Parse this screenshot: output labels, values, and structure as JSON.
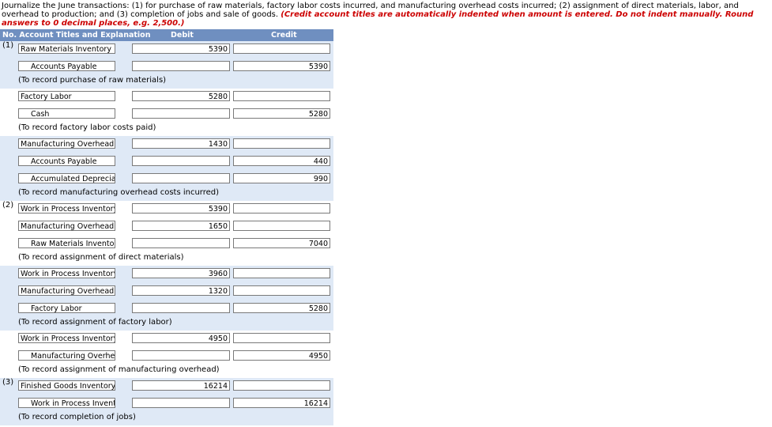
{
  "instructions": {
    "text": "Journalize the June transactions: (1) for purchase of raw materials, factory labor costs incurred, and manufacturing overhead costs incurred; (2) assignment of direct materials, labor, and overhead to production; and (3) completion of jobs and sale of goods.",
    "note": "(Credit account titles are automatically indented when amount is entered. Do not indent manually. Round answers to 0 decimal places, e.g. 2,500.)"
  },
  "header": {
    "col1": "No. Account Titles and Explanation",
    "col2": "Debit",
    "col3": "Credit"
  },
  "entries": [
    {
      "num": "(1)",
      "lines": [
        {
          "account": "Raw Materials Inventory",
          "debit": "5390",
          "credit": ""
        },
        {
          "account": "Accounts Payable",
          "debit": "",
          "credit": "5390"
        }
      ],
      "explanation": "(To record purchase of raw materials)"
    },
    {
      "num": "",
      "lines": [
        {
          "account": "Factory Labor",
          "debit": "5280",
          "credit": ""
        },
        {
          "account": "Cash",
          "debit": "",
          "credit": "5280"
        }
      ],
      "explanation": "(To record factory labor costs paid)"
    },
    {
      "num": "",
      "lines": [
        {
          "account": "Manufacturing Overhead",
          "debit": "1430",
          "credit": ""
        },
        {
          "account": "Accounts Payable",
          "debit": "",
          "credit": "440"
        },
        {
          "account": "Accumulated Depreciat",
          "debit": "",
          "credit": "990"
        }
      ],
      "explanation": "(To record manufacturing overhead costs incurred)"
    },
    {
      "num": "(2)",
      "lines": [
        {
          "account": "Work in Process Inventory",
          "debit": "5390",
          "credit": ""
        },
        {
          "account": "Manufacturing Overhead",
          "debit": "1650",
          "credit": ""
        },
        {
          "account": "Raw Materials Inventor",
          "debit": "",
          "credit": "7040"
        }
      ],
      "explanation": "(To record assignment of direct materials)"
    },
    {
      "num": "",
      "lines": [
        {
          "account": "Work in Process Inventory",
          "debit": "3960",
          "credit": ""
        },
        {
          "account": "Manufacturing Overhead",
          "debit": "1320",
          "credit": ""
        },
        {
          "account": "Factory Labor",
          "debit": "",
          "credit": "5280"
        }
      ],
      "explanation": "(To record assignment of factory labor)"
    },
    {
      "num": "",
      "lines": [
        {
          "account": "Work in Process Inventory",
          "debit": "4950",
          "credit": ""
        },
        {
          "account": "Manufacturing Overhea",
          "debit": "",
          "credit": "4950"
        }
      ],
      "explanation": "(To record assignment of manufacturing overhead)"
    },
    {
      "num": "(3)",
      "lines": [
        {
          "account": "Finished Goods Inventory",
          "debit": "16214",
          "credit": ""
        },
        {
          "account": "Work in Process Invent",
          "debit": "",
          "credit": "16214"
        }
      ],
      "explanation": "(To record completion of jobs)"
    }
  ]
}
